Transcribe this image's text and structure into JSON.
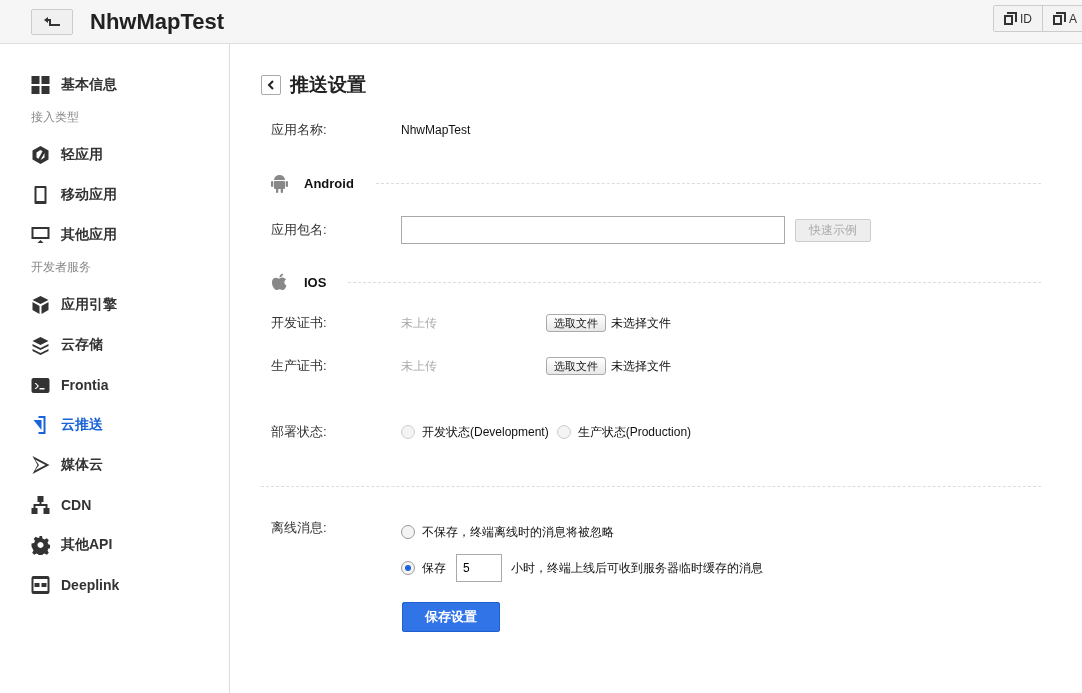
{
  "header": {
    "title": "NhwMapTest",
    "buttons": [
      {
        "label": "ID"
      },
      {
        "label": "A"
      }
    ]
  },
  "sidebar": {
    "items": [
      {
        "kind": "item",
        "label": "基本信息",
        "selected": false
      },
      {
        "kind": "heading",
        "label": "接入类型"
      },
      {
        "kind": "item",
        "label": "轻应用",
        "selected": false
      },
      {
        "kind": "item",
        "label": "移动应用",
        "selected": false
      },
      {
        "kind": "item",
        "label": "其他应用",
        "selected": false
      },
      {
        "kind": "heading",
        "label": "开发者服务"
      },
      {
        "kind": "item",
        "label": "应用引擎",
        "selected": false
      },
      {
        "kind": "item",
        "label": "云存储",
        "selected": false
      },
      {
        "kind": "item",
        "label": "Frontia",
        "selected": false
      },
      {
        "kind": "item",
        "label": "云推送",
        "selected": true
      },
      {
        "kind": "item",
        "label": "媒体云",
        "selected": false
      },
      {
        "kind": "item",
        "label": "CDN",
        "selected": false
      },
      {
        "kind": "item",
        "label": "其他API",
        "selected": false
      },
      {
        "kind": "item",
        "label": "Deeplink",
        "selected": false
      }
    ]
  },
  "page": {
    "title": "推送设置",
    "app_name": {
      "label": "应用名称:",
      "value": "NhwMapTest"
    },
    "android": {
      "title": "Android",
      "package": {
        "label": "应用包名:"
      },
      "example_button": {
        "label": "快速示例",
        "disabled": true
      }
    },
    "ios": {
      "title": "IOS",
      "certs": [
        {
          "label": "开发证书:",
          "status": "未上传",
          "button": "选取文件",
          "file": "未选择文件"
        },
        {
          "label": "生产证书:",
          "status": "未上传",
          "button": "选取文件",
          "file": "未选择文件"
        }
      ],
      "deploy": {
        "label": "部署状态:",
        "options": [
          {
            "label": "开发状态(Development)",
            "selected": false
          },
          {
            "label": "生产状态(Production)",
            "selected": false
          }
        ]
      }
    },
    "offline": {
      "label": "离线消息:",
      "options": [
        {
          "kind": "plain",
          "label": "不保存，终端离线时的消息将被忽略",
          "selected": false
        },
        {
          "kind": "hours",
          "label": "保存",
          "value": "5",
          "suffix": "小时，终端上线后可收到服务器临时缓存的消息",
          "selected": true
        }
      ]
    },
    "save_button": "保存设置"
  }
}
